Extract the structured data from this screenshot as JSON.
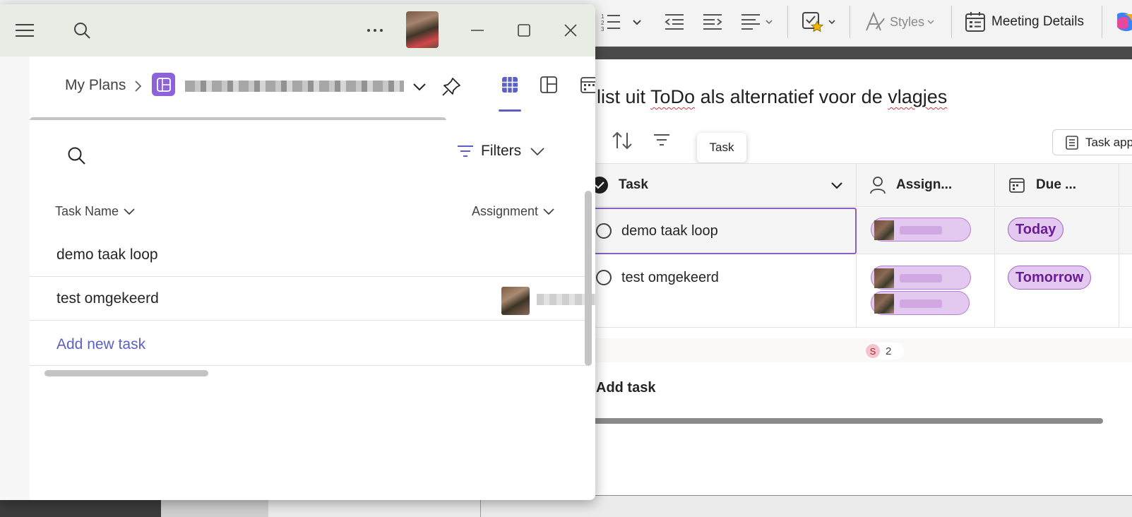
{
  "background_window": {
    "ribbon": {
      "styles_label": "Styles",
      "meeting_details_label": "Meeting Details"
    },
    "loop": {
      "title_parts": [
        "list uit ",
        "ToDo",
        " als alternatief voor de ",
        "vlagjes"
      ],
      "tooltip": "Task",
      "task_app_button": "Task app",
      "table": {
        "columns": {
          "task": "Task",
          "assigned": "Assign...",
          "due": "Due ..."
        },
        "rows": [
          {
            "task": "demo taak loop",
            "due": "Today"
          },
          {
            "task": "test omgekeerd",
            "due": "Tomorrow"
          }
        ],
        "summary": {
          "initial": "S",
          "count": "2"
        }
      },
      "add_task": "Add task"
    }
  },
  "planner": {
    "breadcrumb": {
      "root": "My Plans"
    },
    "filters_label": "Filters",
    "columns": {
      "task_name": "Task Name",
      "assignment": "Assignment"
    },
    "rows": [
      {
        "name": "demo taak loop"
      },
      {
        "name": "test omgekeerd",
        "assignee_tail": "n"
      }
    ],
    "add_new_task": "Add new task"
  },
  "colors": {
    "accent": "#5b5fc7",
    "plan_icon": "#8c63d9",
    "chip_fill": "#e3c8ef",
    "chip_text": "#6a1d94"
  },
  "icons": [
    "hamburger-icon",
    "search-icon",
    "more-icon",
    "minimize-icon",
    "maximize-icon",
    "close-icon",
    "expand-panel-icon",
    "chevron-right-icon",
    "chevron-down-icon",
    "pin-icon",
    "grid-view-icon",
    "board-view-icon",
    "calendar-view-icon",
    "filter-icon",
    "sort-icon",
    "check-circle-icon",
    "person-icon",
    "calendar-icon"
  ]
}
